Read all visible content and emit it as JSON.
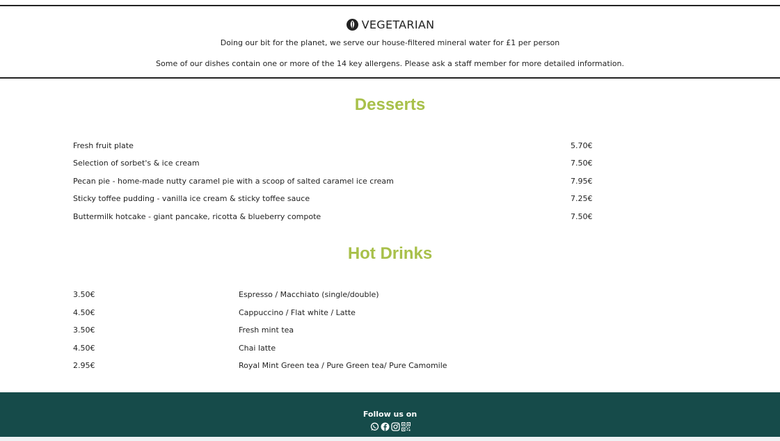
{
  "info": {
    "veg_label": "VEGETARIAN",
    "water_note": "Doing our bit for the planet, we serve our house-filtered mineral water for £1 per person",
    "allergen_note": "Some of our dishes contain one or more of the 14 key allergens. Please ask a staff member for more detailed information."
  },
  "desserts": {
    "title": "Desserts",
    "items": [
      {
        "name": "Fresh fruit plate",
        "price": "5.70€"
      },
      {
        "name": "Selection of sorbet's & ice cream",
        "price": "7.50€"
      },
      {
        "name": "Pecan pie - home-made nutty caramel pie with a scoop of salted caramel ice cream",
        "price": "7.95€"
      },
      {
        "name": "Sticky toffee pudding - vanilla ice cream & sticky toffee sauce",
        "price": "7.25€"
      },
      {
        "name": "Buttermilk hotcake - giant pancake, ricotta & blueberry compote",
        "price": "7.50€"
      }
    ]
  },
  "hot_drinks": {
    "title": "Hot Drinks",
    "items": [
      {
        "price": "3.50€",
        "name": "Espresso / Macchiato (single/double)"
      },
      {
        "price": "4.50€",
        "name": "Cappuccino / Flat white / Latte"
      },
      {
        "price": "3.50€",
        "name": "Fresh mint tea"
      },
      {
        "price": "4.50€",
        "name": "Chai latte"
      },
      {
        "price": "2.95€",
        "name": "Royal Mint Green tea / Pure Green tea/ Pure Camomile"
      }
    ]
  },
  "footer": {
    "follow_label": "Follow us on",
    "social_icons": [
      "whatsapp-icon",
      "facebook-icon",
      "instagram-icon",
      "qr-code-icon"
    ]
  },
  "colors": {
    "accent": "#a8c04a",
    "footer_bg": "#164b4a"
  }
}
